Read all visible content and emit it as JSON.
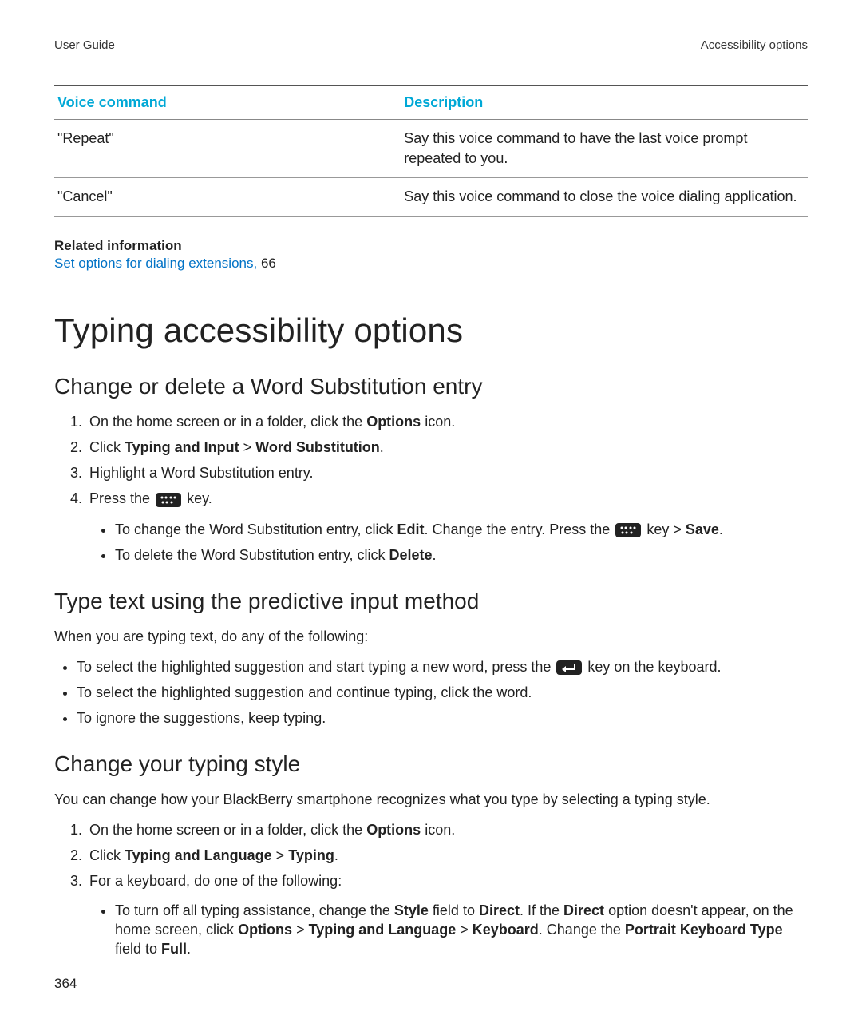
{
  "header": {
    "left": "User Guide",
    "right": "Accessibility options"
  },
  "table": {
    "head": {
      "c1": "Voice command",
      "c2": "Description"
    },
    "rows": [
      {
        "c1": "\"Repeat\"",
        "c2": "Say this voice command to have the last voice prompt repeated to you."
      },
      {
        "c1": "\"Cancel\"",
        "c2": "Say this voice command to close the voice dialing application."
      }
    ]
  },
  "related": {
    "label": "Related information",
    "link_text": "Set options for dialing extensions, ",
    "link_page": "66"
  },
  "h1": "Typing accessibility options",
  "secA": {
    "title": "Change or delete a Word Substitution entry",
    "step1_a": "On the home screen or in a folder, click the ",
    "step1_b": "Options",
    "step1_c": " icon.",
    "step2_a": "Click ",
    "step2_b": "Typing and Input",
    "step2_c": " > ",
    "step2_d": "Word Substitution",
    "step2_e": ".",
    "step3": "Highlight a Word Substitution entry.",
    "step4_a": "Press the ",
    "step4_b": " key.",
    "sub1_a": "To change the Word Substitution entry, click ",
    "sub1_b": "Edit",
    "sub1_c": ". Change the entry. Press the ",
    "sub1_d": " key > ",
    "sub1_e": "Save",
    "sub1_f": ".",
    "sub2_a": "To delete the Word Substitution entry, click ",
    "sub2_b": "Delete",
    "sub2_c": "."
  },
  "secB": {
    "title": "Type text using the predictive input method",
    "intro": "When you are typing text, do any of the following:",
    "b1_a": "To select the highlighted suggestion and start typing a new word, press the ",
    "b1_b": " key on the keyboard.",
    "b2": "To select the highlighted suggestion and continue typing, click the word.",
    "b3": "To ignore the suggestions, keep typing."
  },
  "secC": {
    "title": "Change your typing style",
    "intro": "You can change how your BlackBerry smartphone recognizes what you type by selecting a typing style.",
    "step1_a": "On the home screen or in a folder, click the ",
    "step1_b": "Options",
    "step1_c": " icon.",
    "step2_a": "Click ",
    "step2_b": "Typing and Language",
    "step2_c": " > ",
    "step2_d": "Typing",
    "step2_e": ".",
    "step3": "For a keyboard, do one of the following:",
    "sub1_a": "To turn off all typing assistance, change the ",
    "sub1_b": "Style",
    "sub1_c": " field to ",
    "sub1_d": "Direct",
    "sub1_e": ". If the ",
    "sub1_f": "Direct",
    "sub1_g": " option doesn't appear, on the home screen, click ",
    "sub1_h": "Options",
    "sub1_i": " > ",
    "sub1_j": "Typing and Language",
    "sub1_k": " > ",
    "sub1_l": "Keyboard",
    "sub1_m": ". Change the ",
    "sub1_n": "Portrait Keyboard Type",
    "sub1_o": " field to ",
    "sub1_p": "Full",
    "sub1_q": "."
  },
  "page_number": "364"
}
